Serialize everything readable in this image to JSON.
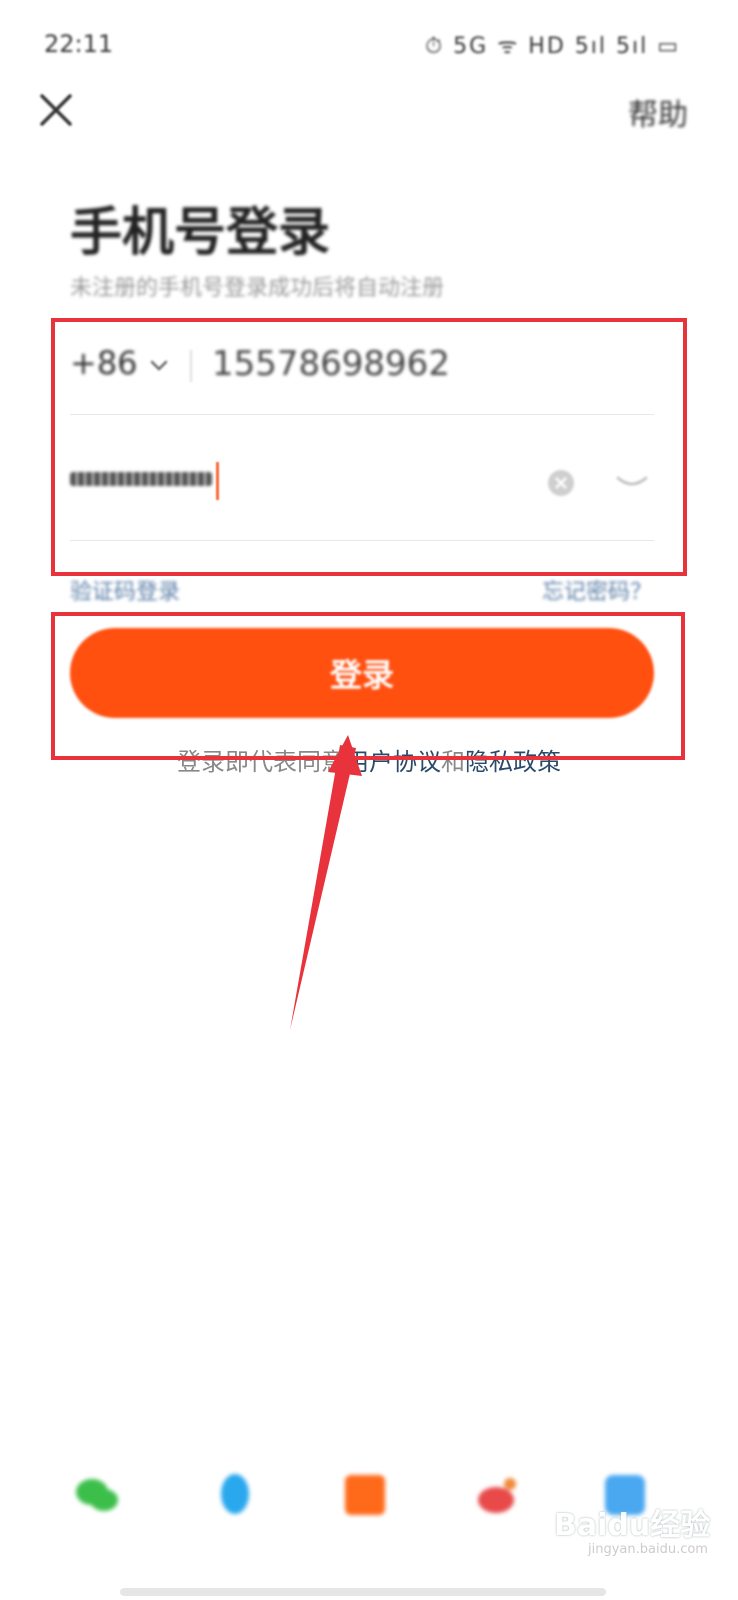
{
  "status_bar": {
    "time": "22:11",
    "icons_text": "⏱ 5G  ᯤ HD 5ıl 5ıl ▭"
  },
  "header": {
    "close_icon": "close-icon",
    "help_label": "帮助"
  },
  "title": "手机号登录",
  "subtitle": "未注册的手机号登录成功后将自动注册",
  "phone": {
    "country_code": "+86",
    "value": "15578698962"
  },
  "password": {
    "filled": true
  },
  "links": {
    "sms_login": "验证码登录",
    "forgot_password": "忘记密码？"
  },
  "login_button": "登录",
  "agreement": {
    "prefix": "登录即代表同意",
    "user_agreement": "用户协议",
    "and": "和",
    "privacy_policy": "隐私政策"
  },
  "social_logins": [
    "wechat-icon",
    "qq-icon",
    "xiaomi-icon",
    "weibo-icon",
    "other-icon"
  ],
  "colors": {
    "accent": "#ff5010",
    "annotation": "#e8323c",
    "link": "#2a4a6a"
  },
  "watermark": {
    "brand": "Baidu经验",
    "sub": "jingyan.baidu.com"
  }
}
